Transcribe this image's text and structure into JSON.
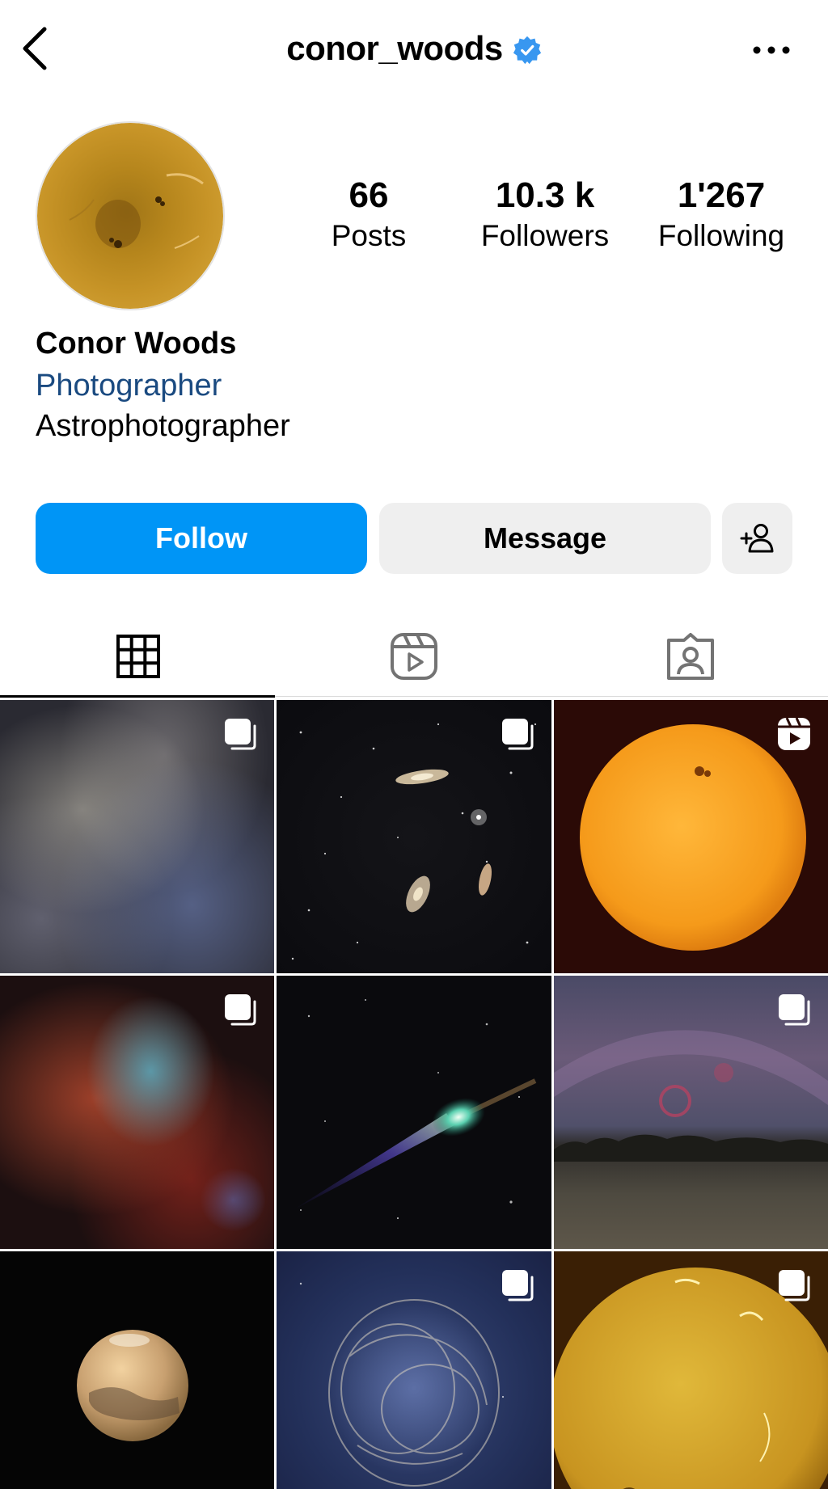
{
  "header": {
    "username": "conor_woods",
    "verified_icon": "verified-badge-icon",
    "back_icon": "chevron-left-icon",
    "more_icon": "more-horizontal-icon"
  },
  "profile": {
    "avatar_icon": "avatar-image",
    "stats": [
      {
        "value": "66",
        "label": "Posts"
      },
      {
        "value": "10.3 k",
        "label": "Followers"
      },
      {
        "value": "1'267",
        "label": "Following"
      }
    ],
    "name": "Conor Woods",
    "category": "Photographer",
    "bio": "Astrophotographer"
  },
  "actions": {
    "follow_label": "Follow",
    "message_label": "Message",
    "add_user_icon": "add-user-icon"
  },
  "tabs": [
    {
      "icon": "grid-icon",
      "active": true
    },
    {
      "icon": "reels-icon",
      "active": false
    },
    {
      "icon": "tagged-icon",
      "active": false
    }
  ],
  "posts": [
    {
      "subject": "dust nebula",
      "badge": "carousel"
    },
    {
      "subject": "galaxy trio",
      "badge": "carousel"
    },
    {
      "subject": "sun",
      "badge": "reel"
    },
    {
      "subject": "seagull nebula",
      "badge": "carousel"
    },
    {
      "subject": "comet",
      "badge": "none"
    },
    {
      "subject": "milky way panorama",
      "badge": "carousel"
    },
    {
      "subject": "mars",
      "badge": "none"
    },
    {
      "subject": "supernova remnant",
      "badge": "carousel"
    },
    {
      "subject": "sun close-up",
      "badge": "carousel"
    }
  ],
  "colors": {
    "follow_button": "#0095f6",
    "secondary_button": "#efefef",
    "category_link": "#1a4a80",
    "verified": "#3897f0"
  }
}
